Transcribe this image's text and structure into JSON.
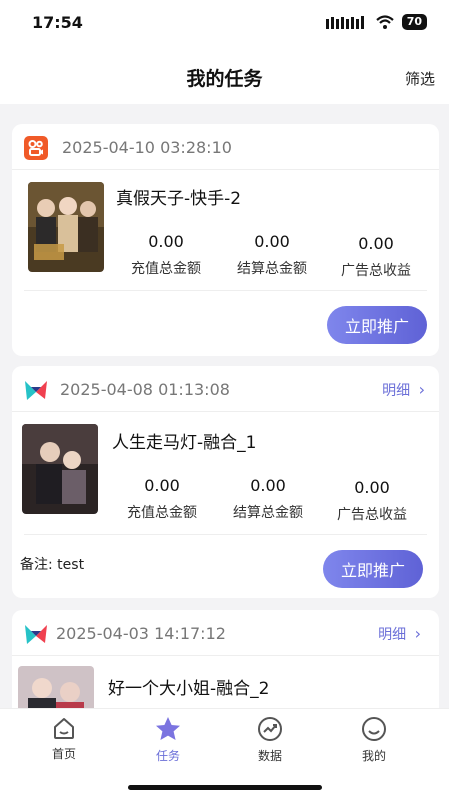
{
  "status": {
    "time": "17:54",
    "battery": "70"
  },
  "header": {
    "title": "我的任务",
    "filter": "筛选"
  },
  "labels": {
    "detail": "明细",
    "promote": "立即推广",
    "recharge": "充值总金额",
    "settle": "结算总金额",
    "ad": "广告总收益"
  },
  "cards": [
    {
      "platform": "kuaishou-icon",
      "date": "2025-04-10 03:28:10",
      "title": "真假天子-快手-2",
      "recharge": "0.00",
      "settle": "0.00",
      "ad": "0.00",
      "has_detail": false,
      "note": ""
    },
    {
      "platform": "bird-icon",
      "date": "2025-04-08 01:13:08",
      "title": "人生走马灯-融合_1",
      "recharge": "0.00",
      "settle": "0.00",
      "ad": "0.00",
      "has_detail": true,
      "note": "备注: test"
    },
    {
      "platform": "bird-icon",
      "date": "2025-04-03 14:17:12",
      "title": "好一个大小姐-融合_2",
      "has_detail": true
    }
  ],
  "tabs": [
    {
      "label": "首页",
      "icon": "home-icon"
    },
    {
      "label": "任务",
      "icon": "star-icon",
      "active": true
    },
    {
      "label": "数据",
      "icon": "chart-icon"
    },
    {
      "label": "我的",
      "icon": "smile-icon"
    }
  ],
  "colors": {
    "accent": "#6b6fd8",
    "kuaishou": "#f05a28"
  }
}
